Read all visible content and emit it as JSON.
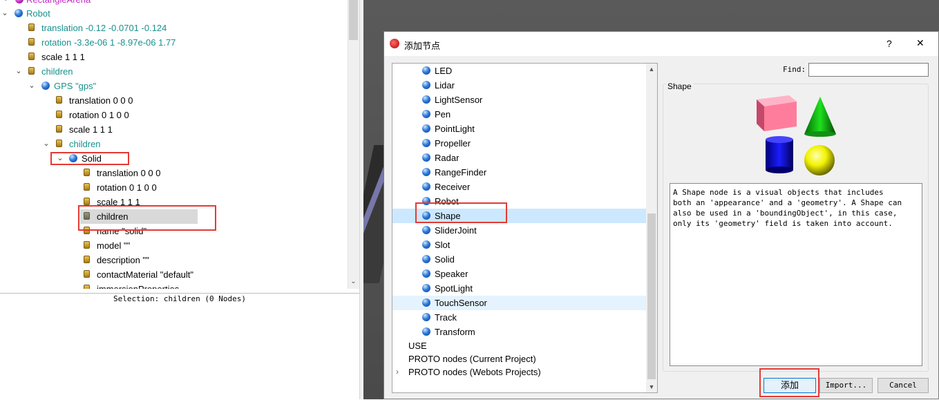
{
  "scene_tree": {
    "rows": [
      {
        "label": "RectangleArena"
      },
      {
        "label": "Robot"
      },
      {
        "label": "translation -0.12 -0.0701 -0.124"
      },
      {
        "label": "rotation -3.3e-06 1 -8.97e-06 1.77"
      },
      {
        "label": "scale 1 1 1"
      },
      {
        "label": "children"
      },
      {
        "label": "GPS \"gps\""
      },
      {
        "label": "translation 0 0 0"
      },
      {
        "label": "rotation 0 1 0 0"
      },
      {
        "label": "scale 1 1 1"
      },
      {
        "label": "children"
      },
      {
        "label": "Solid"
      },
      {
        "label": "translation 0 0 0"
      },
      {
        "label": "rotation 0 1 0 0"
      },
      {
        "label": "scale 1 1 1"
      },
      {
        "label": "children"
      },
      {
        "label": "name \"solid\""
      },
      {
        "label": "model \"\""
      },
      {
        "label": "description \"\""
      },
      {
        "label": "contactMaterial \"default\""
      },
      {
        "label": "immersionProperties"
      }
    ]
  },
  "selection_text": "Selection: children (0 Nodes)",
  "dialog": {
    "title": "添加节点",
    "help_label": "?",
    "close_label": "✕",
    "node_list": [
      "LED",
      "Lidar",
      "LightSensor",
      "Pen",
      "PointLight",
      "Propeller",
      "Radar",
      "RangeFinder",
      "Receiver",
      "Robot",
      "Shape",
      "SliderJoint",
      "Slot",
      "Solid",
      "Speaker",
      "SpotLight",
      "TouchSensor",
      "Track",
      "Transform"
    ],
    "selected_node": "Shape",
    "groups": [
      "USE",
      "PROTO nodes (Current Project)",
      "PROTO nodes (Webots Projects)"
    ],
    "find_label": "Find:",
    "find_value": "",
    "preview_title": "Shape",
    "description": "A Shape node is a visual objects that includes\nboth an 'appearance' and a 'geometry'. A Shape can\nalso be used in a 'boundingObject', in this case,\nonly its 'geometry' field is taken into account.",
    "buttons": {
      "add": "添加",
      "import": "Import...",
      "cancel": "Cancel"
    }
  },
  "colors": {
    "highlight_red": "#e53935",
    "selection_blue": "#cce8ff",
    "field_cyan": "#17918d"
  }
}
